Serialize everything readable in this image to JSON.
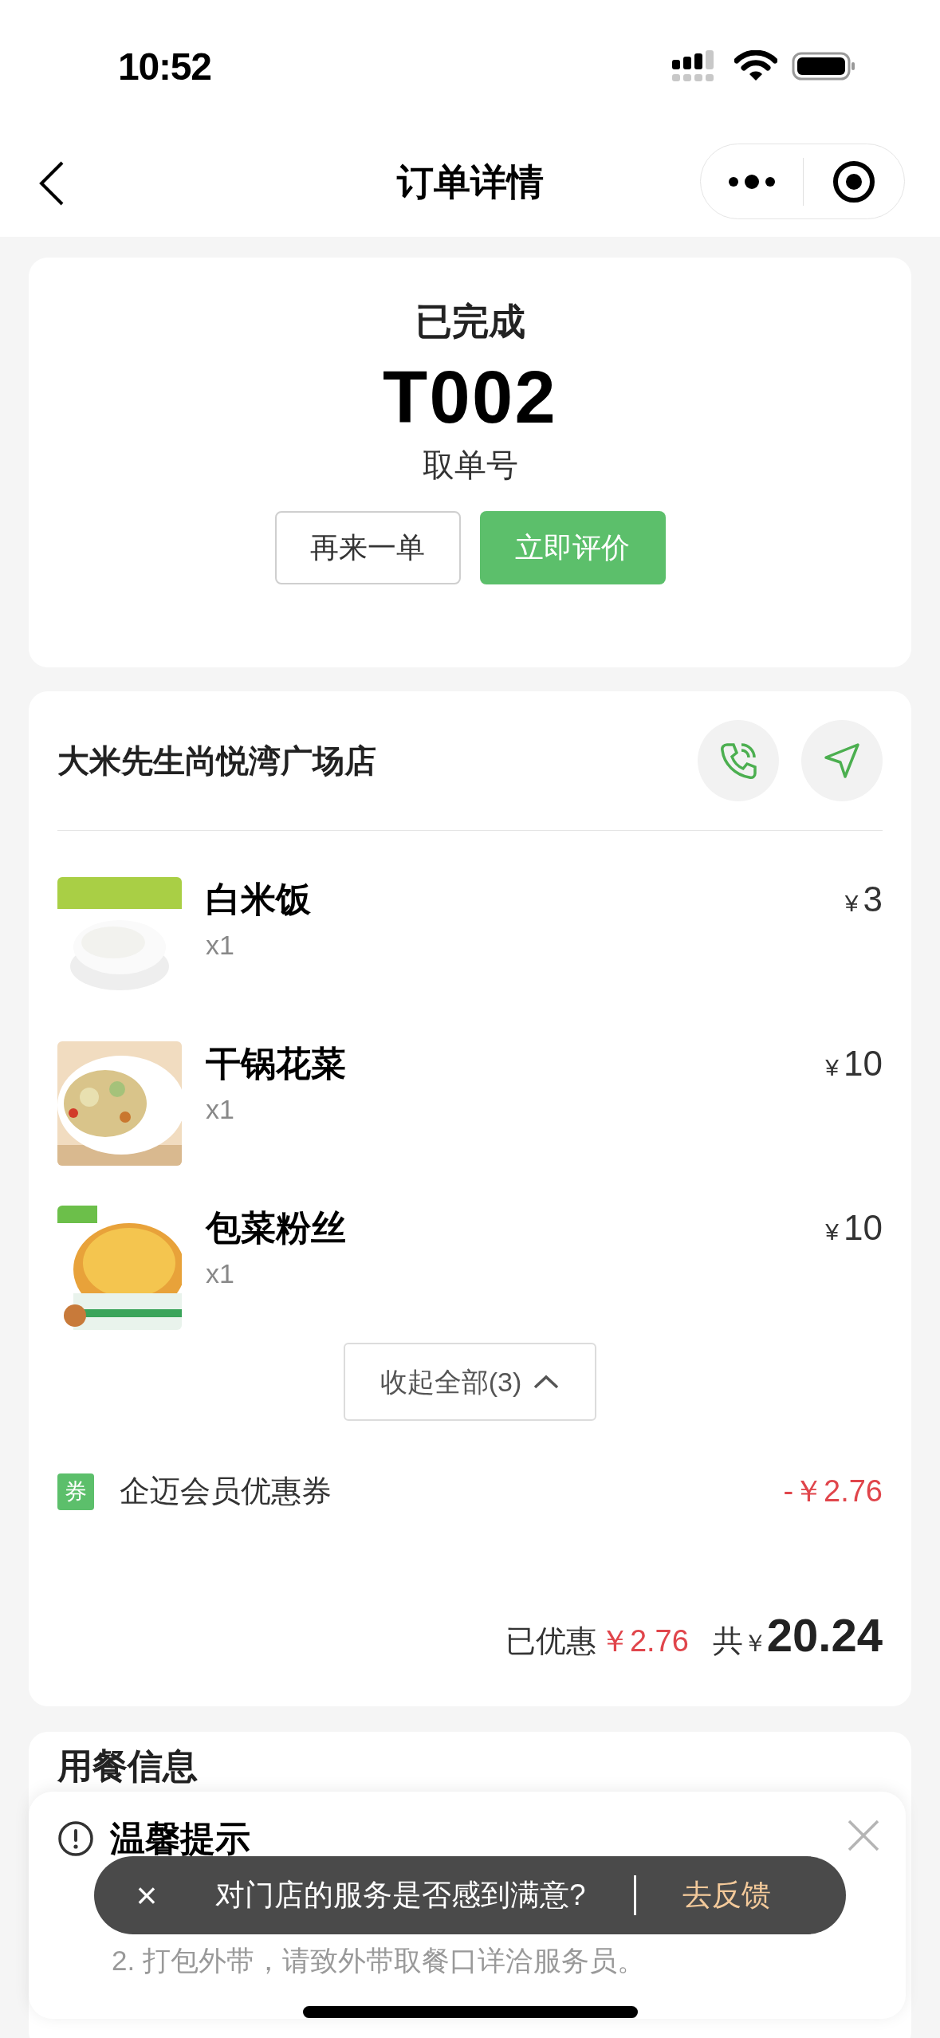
{
  "status_bar": {
    "time": "10:52"
  },
  "nav": {
    "title": "订单详情"
  },
  "order": {
    "status": "已完成",
    "pickup_code": "T002",
    "pickup_label": "取单号",
    "buttons": [
      {
        "label": "再来一单",
        "kind": "outline"
      },
      {
        "label": "立即评价",
        "kind": "primary"
      }
    ]
  },
  "store": {
    "name": "大米先生尚悦湾广场店",
    "items": [
      {
        "name": "白米饭",
        "qty": "x1",
        "currency": "¥",
        "price": "3"
      },
      {
        "name": "干锅花菜",
        "qty": "x1",
        "currency": "¥",
        "price": "10"
      },
      {
        "name": "包菜粉丝",
        "qty": "x1",
        "currency": "¥",
        "price": "10"
      }
    ],
    "collapse_button": "收起全部(3)",
    "coupon": {
      "badge": "券",
      "name": "企迈会员优惠券",
      "amount": "-￥2.76"
    },
    "summary": {
      "discount_label": "已优惠",
      "discount": "￥2.76",
      "total_label": "共",
      "currency": "￥",
      "total": "20.24"
    }
  },
  "dining_info": {
    "title": "用餐信息"
  },
  "tips": {
    "title": "温馨提示",
    "lines": [
      "2. 打包外带，请致外带取餐口详洽服务员。"
    ]
  },
  "toast": {
    "close": "×",
    "message": "对门店的服务是否感到满意?",
    "action": "去反馈"
  }
}
